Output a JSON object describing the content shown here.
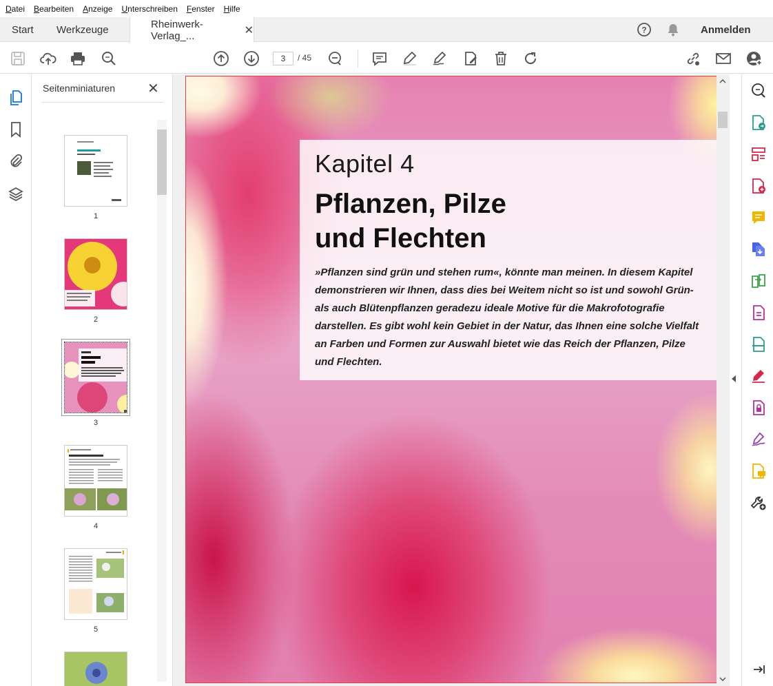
{
  "menu": [
    "Datei",
    "Bearbeiten",
    "Anzeige",
    "Unterschreiben",
    "Fenster",
    "Hilfe"
  ],
  "tabs": {
    "start": "Start",
    "tools": "Werkzeuge",
    "document": "Rheinwerk-Verlag_...",
    "close": "✕",
    "signin": "Anmelden"
  },
  "toolbar": {
    "current_page": "3",
    "page_of": "/  45"
  },
  "thumbnails": {
    "title": "Seitenminiaturen",
    "pages": [
      "1",
      "2",
      "3",
      "4",
      "5"
    ]
  },
  "document": {
    "chapter": "Kapitel 4",
    "headline_line1": "Pflanzen, Pilze",
    "headline_line2": "und Flechten",
    "intro": "»Pflanzen sind grün und stehen rum«, könnte man meinen. In diesem Kapitel demonstrieren wir Ihnen, dass dies bei Weitem nicht so ist und sowohl Grün- als auch Blütenpflanzen geradezu ideale Motive für die Makrofotografie darstellen. Es gibt wohl kein Gebiet in der Natur, das Ihnen eine solche Vielfalt an Farben und Formen zur Auswahl bietet wie das Reich der Pflanzen, Pilze und Flechten."
  },
  "colors": {
    "accent_blue": "#1473e6",
    "icon_gray": "#555555"
  }
}
